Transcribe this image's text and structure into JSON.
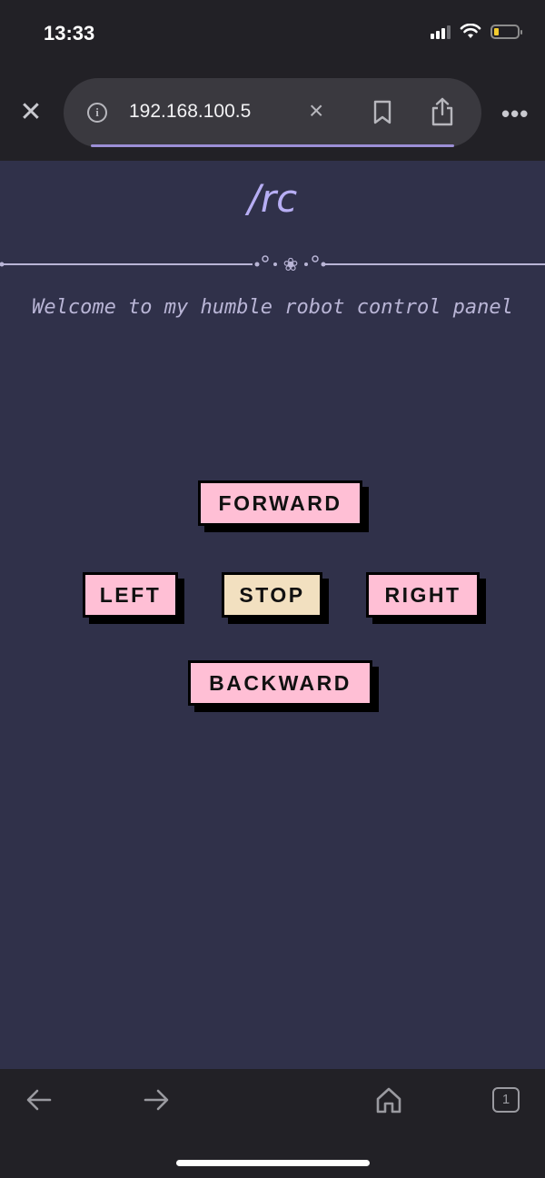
{
  "status_bar": {
    "time": "13:33",
    "icons": [
      "signal-icon",
      "wifi-icon",
      "battery-icon"
    ],
    "battery_color": "#f3cc2f"
  },
  "browser": {
    "url": "192.168.100.5",
    "icons": [
      "close-icon",
      "info-icon",
      "clear-icon",
      "bookmark-icon",
      "share-icon",
      "more-icon"
    ],
    "progress_color": "#9c8fd6"
  },
  "page": {
    "title": "/rc",
    "welcome": "Welcome to my humble robot control panel",
    "title_color": "#b7aef4",
    "background": "#30314a"
  },
  "controls": {
    "forward": "FORWARD",
    "left": "LEFT",
    "stop": "STOP",
    "right": "RIGHT",
    "backward": "BACKWARD",
    "button_color": "#ffbfd5",
    "stop_color": "#f2e0c0"
  },
  "toolbar": {
    "icons": [
      "back-arrow-icon",
      "forward-arrow-icon",
      "home-icon",
      "tabs-icon"
    ],
    "tab_count": "1"
  }
}
